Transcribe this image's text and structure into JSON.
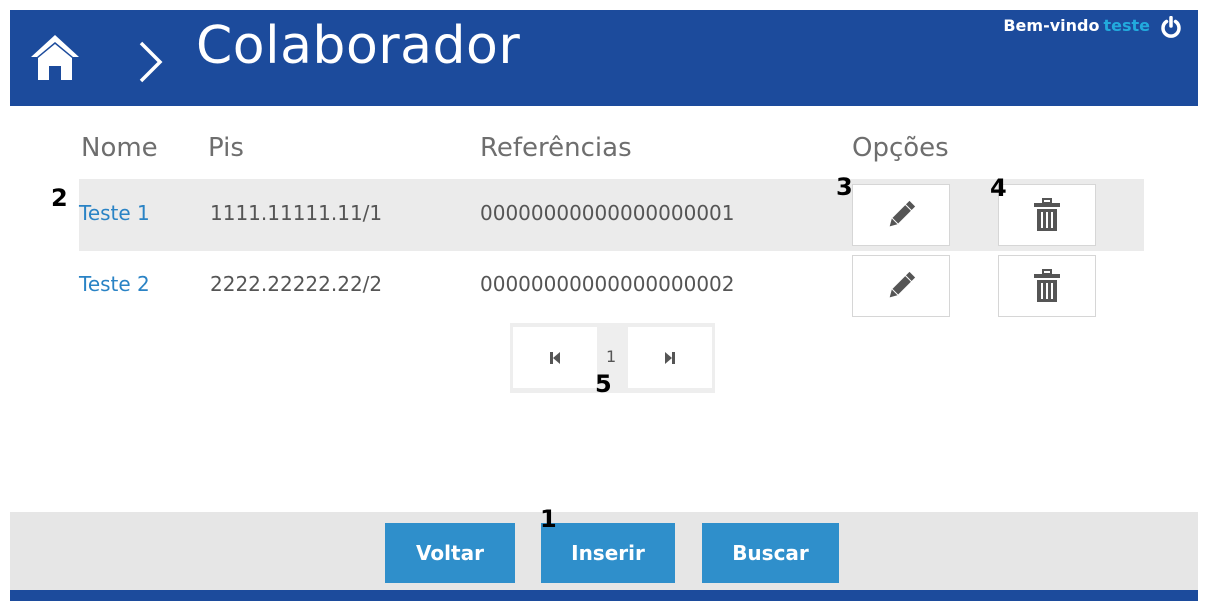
{
  "header": {
    "title": "Colaborador",
    "welcome_label": "Bem-vindo",
    "username": "teste",
    "home_icon": "home-icon",
    "breadcrumb_icon": "chevron-right-icon",
    "logout_icon": "power-icon"
  },
  "table": {
    "columns": [
      "Nome",
      "Pis",
      "Referências",
      "Opções"
    ],
    "rows": [
      {
        "nome": "Teste 1",
        "pis": "1111.11111.11/1",
        "referencias": "00000000000000000001"
      },
      {
        "nome": "Teste 2",
        "pis": "2222.22222.22/2",
        "referencias": "00000000000000000002"
      }
    ],
    "option_icons": [
      "pencil-icon",
      "trash-icon"
    ]
  },
  "pagination": {
    "current_page": "1",
    "first_icon": "first-page-icon",
    "last_icon": "last-page-icon"
  },
  "footer": {
    "voltar_label": "Voltar",
    "inserir_label": "Inserir",
    "buscar_label": "Buscar"
  },
  "annotations": {
    "m1": "1",
    "m2": "2",
    "m3": "3",
    "m4": "4",
    "m5": "5"
  },
  "colors": {
    "header_blue": "#1c4b9c",
    "button_blue": "#2f8fcb",
    "link_blue": "#2a83c5",
    "username_cyan": "#22aadd",
    "row_highlight": "#ebebeb"
  }
}
